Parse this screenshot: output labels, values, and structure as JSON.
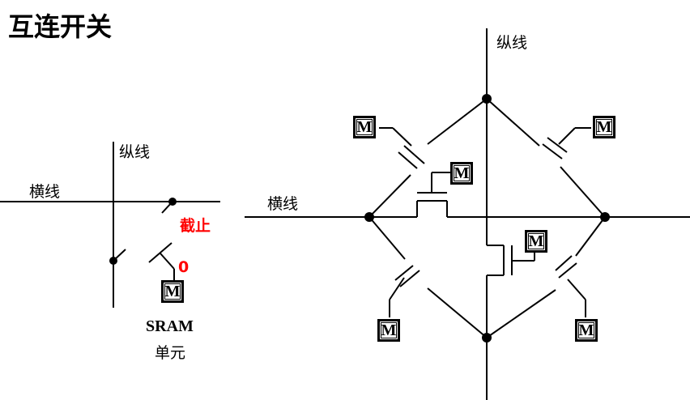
{
  "title": "互连开关",
  "left": {
    "vertical_label": "纵线",
    "horizontal_label": "横线",
    "state_label": "截止",
    "bit_value": "0",
    "memory_label": "M",
    "sram_label": "SRAM",
    "cell_label": "单元"
  },
  "right": {
    "vertical_label": "纵线",
    "horizontal_label": "横线",
    "memory_label": "M"
  },
  "colors": {
    "line": "#000000",
    "highlight": "#ff0000"
  }
}
